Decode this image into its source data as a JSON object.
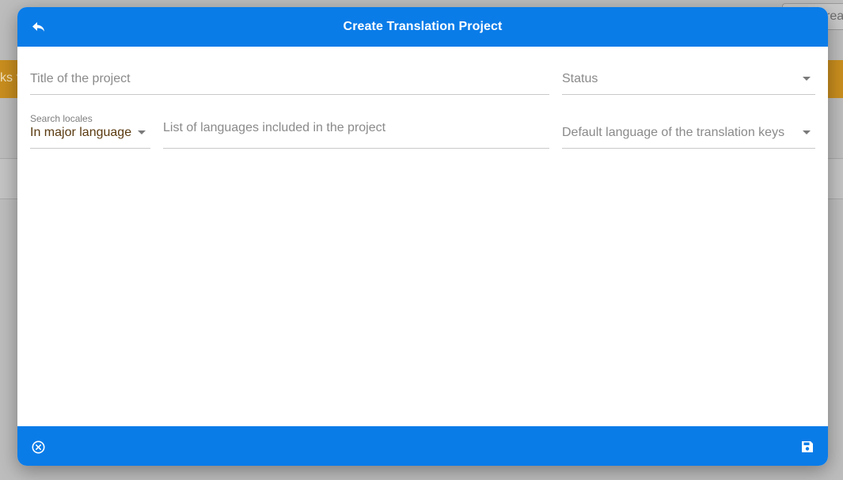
{
  "background": {
    "banner_text": "ks f",
    "top_button_label": "rea"
  },
  "dialog": {
    "title": "Create Translation Project",
    "back_icon": "reply-arrow-icon",
    "cancel_icon": "cancel-circle-icon",
    "save_icon": "floppy-disk-icon",
    "accent_color": "#0a7ce8"
  },
  "form": {
    "title_field": {
      "placeholder": "Title of the project",
      "value": ""
    },
    "status_field": {
      "placeholder": "Status"
    },
    "locale_search": {
      "label": "Search locales",
      "value": "In major language"
    },
    "languages_field": {
      "placeholder": "List of languages included in the project",
      "value": ""
    },
    "default_language_field": {
      "placeholder": "Default language of the translation keys"
    }
  }
}
